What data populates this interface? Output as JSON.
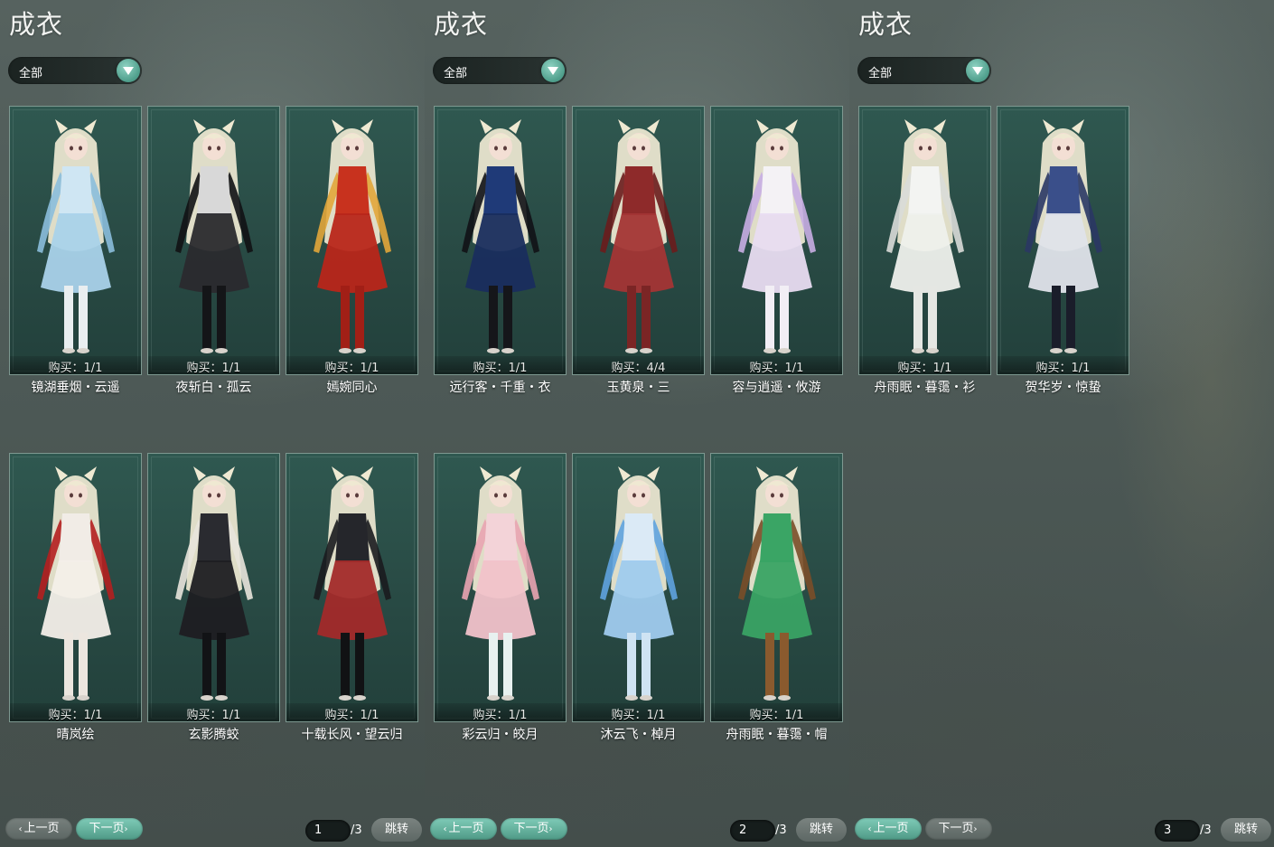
{
  "panels": [
    {
      "title": "成衣",
      "filter": "全部",
      "prev": "上一页",
      "next": "下一页",
      "page": "1",
      "total": "/3",
      "jump": "跳转",
      "items": [
        {
          "buy": "购买：1/1",
          "name": "镜湖垂烟・云遥",
          "hair": "#efe9d2",
          "top": "#cfe6f3",
          "skirt": "#a9d2ea",
          "accent": "#8bbedc",
          "legs": "#e9eef0"
        },
        {
          "buy": "购买：1/1",
          "name": "夜斩白・孤云",
          "hair": "#efe9d2",
          "top": "#d8d8d8",
          "skirt": "#2a2a2e",
          "accent": "#111214",
          "legs": "#141518"
        },
        {
          "buy": "购买：1/1",
          "name": "嫣婉同心",
          "hair": "#efe9d2",
          "top": "#c8321e",
          "skirt": "#b8261a",
          "accent": "#e2a63a",
          "legs": "#a11f16"
        },
        {
          "buy": "购买：1/1",
          "name": "晴岚绘",
          "hair": "#efe9d2",
          "top": "#f1ece6",
          "skirt": "#f3efe9",
          "accent": "#b41f1f",
          "legs": "#ece6df"
        },
        {
          "buy": "购买：1/1",
          "name": "玄影腾蛟",
          "hair": "#efe9d2",
          "top": "#2a2b30",
          "skirt": "#1d1e22",
          "accent": "#e8e4dc",
          "legs": "#121316"
        },
        {
          "buy": "购买：1/1",
          "name": "十载长风・望云归",
          "hair": "#efe9d2",
          "top": "#25262b",
          "skirt": "#a22a2a",
          "accent": "#1a1b1e",
          "legs": "#111214"
        }
      ]
    },
    {
      "title": "成衣",
      "filter": "全部",
      "prev": "上一页",
      "next": "下一页",
      "page": "2",
      "total": "/3",
      "jump": "跳转",
      "items": [
        {
          "buy": "购买：1/1",
          "name": "远行客・千重・衣",
          "hair": "#efe9d2",
          "top": "#1f3a78",
          "skirt": "#192d5e",
          "accent": "#111216",
          "legs": "#15161a"
        },
        {
          "buy": "购买：4/4",
          "name": "玉黄泉・三",
          "hair": "#efe9d2",
          "top": "#8e2a2a",
          "skirt": "#a33535",
          "accent": "#6a1c1c",
          "legs": "#7b2525"
        },
        {
          "buy": "购买：1/1",
          "name": "容与逍遥・攸游",
          "hair": "#efe9d2",
          "top": "#f4f2f5",
          "skirt": "#e8dcf1",
          "accent": "#c8aee3",
          "legs": "#f2eef5"
        },
        {
          "buy": "购买：1/1",
          "name": "彩云归・皎月",
          "hair": "#efe9d2",
          "top": "#f3d3d8",
          "skirt": "#f1c2ca",
          "accent": "#e9a4b1",
          "legs": "#e8f1f0"
        },
        {
          "buy": "购买：1/1",
          "name": "沐云飞・棹月",
          "hair": "#efe9d2",
          "top": "#dbeaf6",
          "skirt": "#9fcbee",
          "accent": "#5fa3df",
          "legs": "#cfe3f3"
        },
        {
          "buy": "购买：1/1",
          "name": "舟雨眠・暮霭・帽",
          "hair": "#efe9d2",
          "top": "#3aa565",
          "skirt": "#39a364",
          "accent": "#7a4e28",
          "legs": "#8a5a2e"
        }
      ]
    },
    {
      "title": "成衣",
      "filter": "全部",
      "prev": "上一页",
      "next": "下一页",
      "page": "3",
      "total": "/3",
      "jump": "跳转",
      "items": [
        {
          "buy": "购买：1/1",
          "name": "舟雨眠・暮霭・衫",
          "hair": "#efe9d2",
          "top": "#f3f4f2",
          "skirt": "#eef0ec",
          "accent": "#d9dcd8",
          "legs": "#e5e7e3"
        },
        {
          "buy": "购买：1/1",
          "name": "贺华岁・惊蛰",
          "hair": "#efe9d2",
          "top": "#3a4f8a",
          "skirt": "#dfe3ea",
          "accent": "#2a3764",
          "legs": "#1a1d2a"
        }
      ]
    }
  ]
}
